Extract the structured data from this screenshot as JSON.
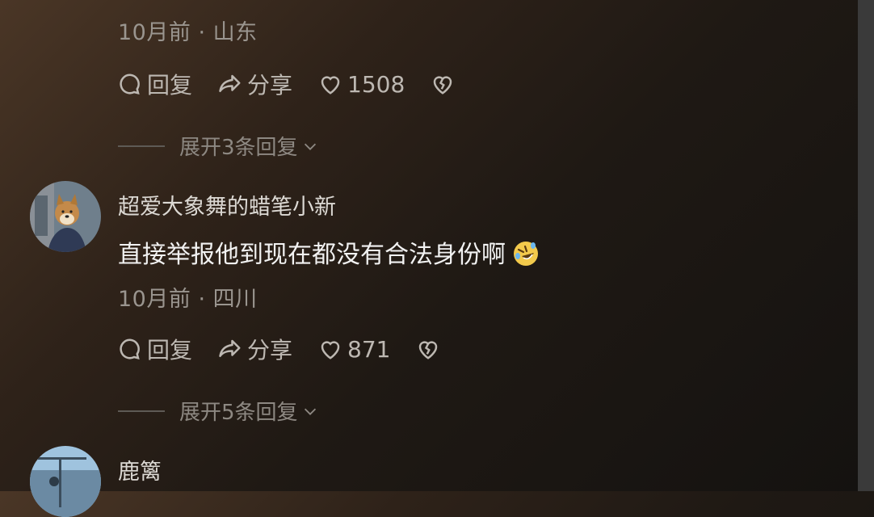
{
  "comments": [
    {
      "meta": "10月前 · 山东",
      "actions": {
        "reply": "回复",
        "share": "分享",
        "likes": "1508"
      },
      "expand": "展开3条回复"
    },
    {
      "username": "超爱大象舞的蜡笔小新",
      "text": "直接举报他到现在都没有合法身份啊",
      "emoji": "rolling-on-floor-laughing-emoji",
      "meta": "10月前 · 四川",
      "actions": {
        "reply": "回复",
        "share": "分享",
        "likes": "871"
      },
      "expand": "展开5条回复"
    },
    {
      "username": "鹿篱"
    }
  ],
  "colors": {
    "accent": "#f2c94c",
    "text": "#f2f2f2",
    "muted": "#9a958f"
  }
}
